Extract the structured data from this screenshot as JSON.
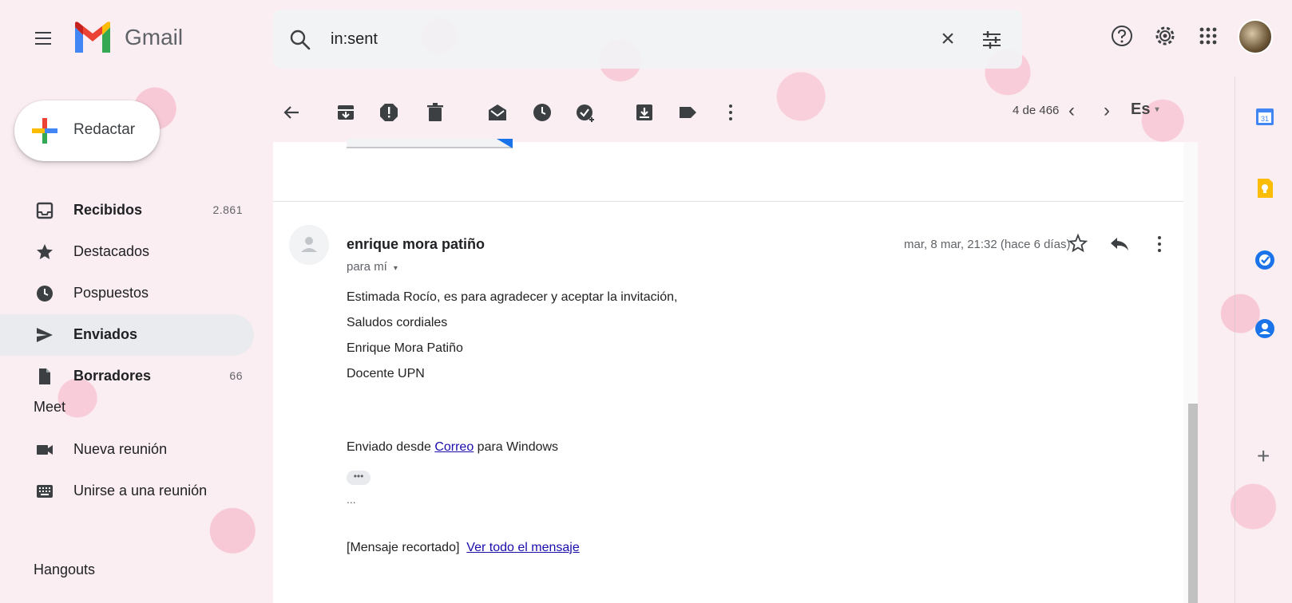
{
  "header": {
    "app_name": "Gmail",
    "search": {
      "value": "in:sent",
      "clear_label": "×"
    }
  },
  "sidebar": {
    "compose_label": "Redactar",
    "items": [
      {
        "label": "Recibidos",
        "count": "2.861",
        "bold": true,
        "icon": "inbox-icon"
      },
      {
        "label": "Destacados",
        "count": "",
        "bold": false,
        "icon": "star-icon"
      },
      {
        "label": "Pospuestos",
        "count": "",
        "bold": false,
        "icon": "clock-icon"
      },
      {
        "label": "Enviados",
        "count": "",
        "bold": true,
        "icon": "send-icon",
        "active": true
      },
      {
        "label": "Borradores",
        "count": "66",
        "bold": true,
        "icon": "draft-icon"
      }
    ],
    "meet": {
      "title": "Meet",
      "items": [
        {
          "label": "Nueva reunión",
          "icon": "video-icon"
        },
        {
          "label": "Unirse a una reunión",
          "icon": "keyboard-icon"
        }
      ]
    },
    "hangouts": {
      "title": "Hangouts"
    }
  },
  "toolbar": {
    "pager": "4 de 466",
    "prev": "‹",
    "next": "›",
    "language": "Es",
    "language_caret": "▾"
  },
  "message": {
    "sender": "enrique mora patiño",
    "recipient": "para mí",
    "recipient_caret": "▾",
    "date": "mar, 8 mar, 21:32 (hace 6 días)",
    "body": {
      "line1": "Estimada Rocío, es para agradecer y aceptar la invitación,",
      "line2": "Saludos cordiales",
      "line3": "Enrique Mora Patiño",
      "line4": "Docente UPN",
      "sent_from_prefix": "Enviado desde ",
      "sent_from_link": "Correo",
      "sent_from_suffix": " para Windows",
      "more_dots": "•••",
      "ellipsis": "...",
      "clipped_label": "[Mensaje recortado]",
      "view_all_link": "Ver todo el mensaje"
    }
  },
  "colors": {
    "accent": "#1a73e8",
    "link": "#1a0dab",
    "calendar": "#4285f4",
    "keep": "#fbbc04",
    "tasks": "#1a73e8",
    "contacts": "#1a73e8"
  }
}
